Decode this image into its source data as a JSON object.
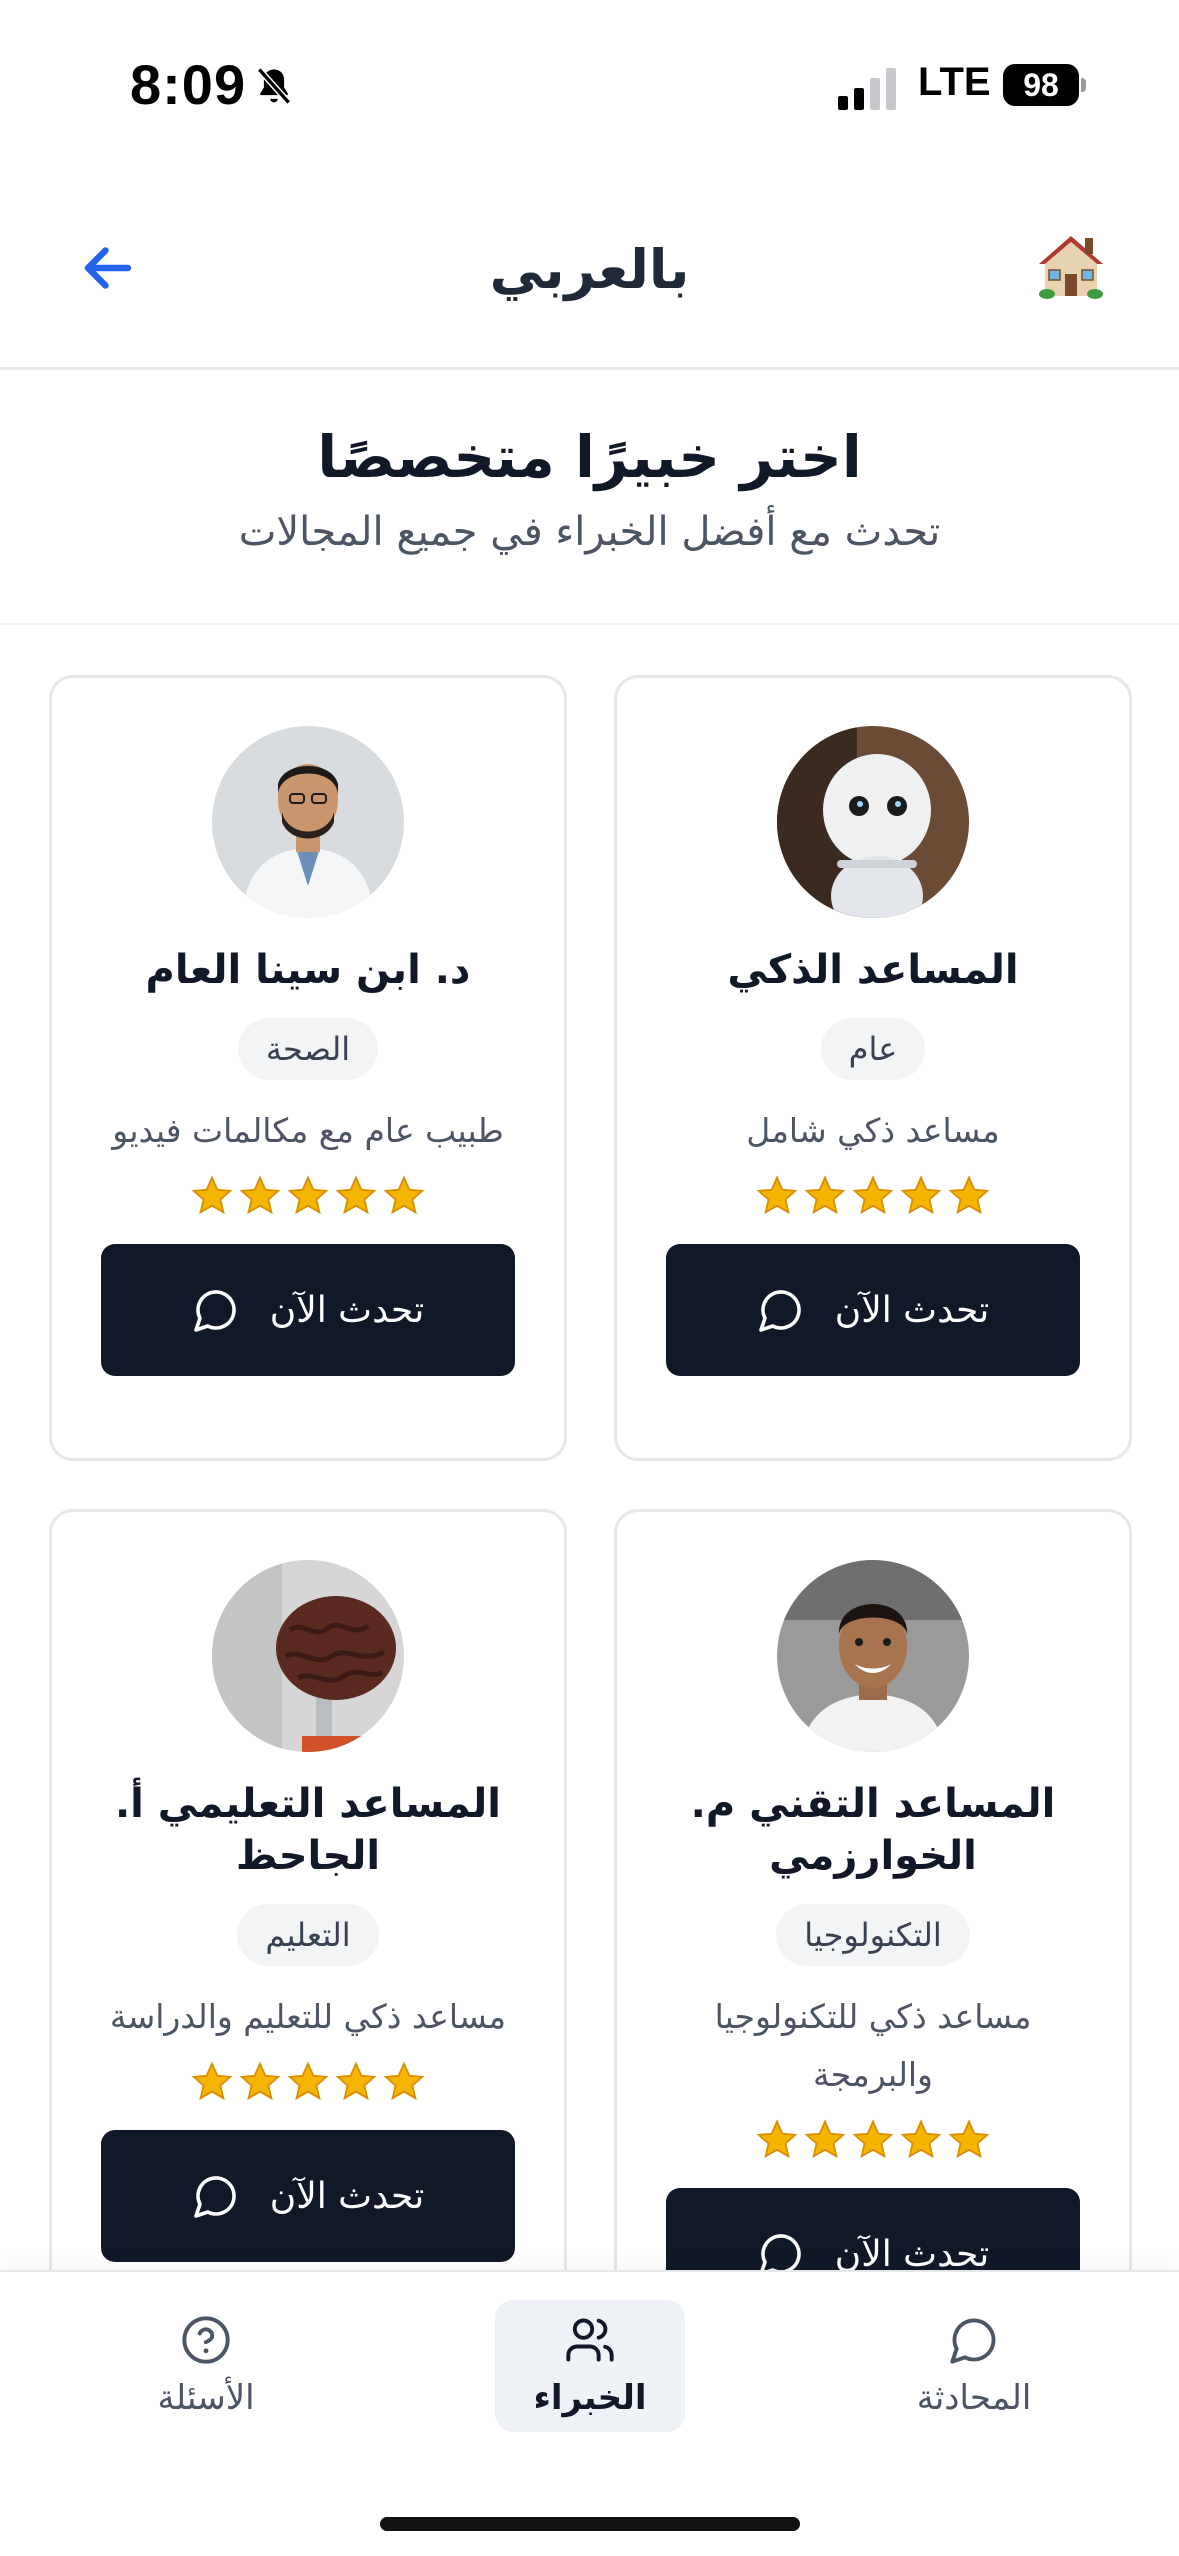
{
  "status_bar": {
    "time": "8:09",
    "network": "LTE",
    "battery": "98"
  },
  "header": {
    "title": "بالعربي",
    "home_icon": "house-icon",
    "back_icon": "arrow-left-icon"
  },
  "intro": {
    "title": "اختر خبيرًا متخصصًا",
    "subtitle": "تحدث مع أفضل الخبراء في جميع المجالات"
  },
  "experts": [
    {
      "name": "المساعد الذكي",
      "category": "عام",
      "description": "مساعد ذكي شامل",
      "rating": 5,
      "button": "تحدث الآن"
    },
    {
      "name": "د. ابن سينا العام",
      "category": "الصحة",
      "description": "طبيب عام مع مكالمات فيديو",
      "rating": 5,
      "button": "تحدث الآن"
    },
    {
      "name": "المساعد التقني م. الخوارزمي",
      "category": "التكنولوجيا",
      "description": "مساعد ذكي للتكنولوجيا والبرمجة",
      "rating": 5,
      "button": "تحدث الآن"
    },
    {
      "name": "المساعد التعليمي أ. الجاحظ",
      "category": "التعليم",
      "description": "مساعد ذكي للتعليم والدراسة",
      "rating": 5,
      "button": "تحدث الآن"
    }
  ],
  "nav": {
    "chat": "المحادثة",
    "experts": "الخبراء",
    "questions": "الأسئلة",
    "active": "experts"
  },
  "colors": {
    "primary": "#111827",
    "muted": "#4b5563",
    "border": "#e5e7eb",
    "accent": "#2563eb",
    "star": "#f5b400"
  }
}
